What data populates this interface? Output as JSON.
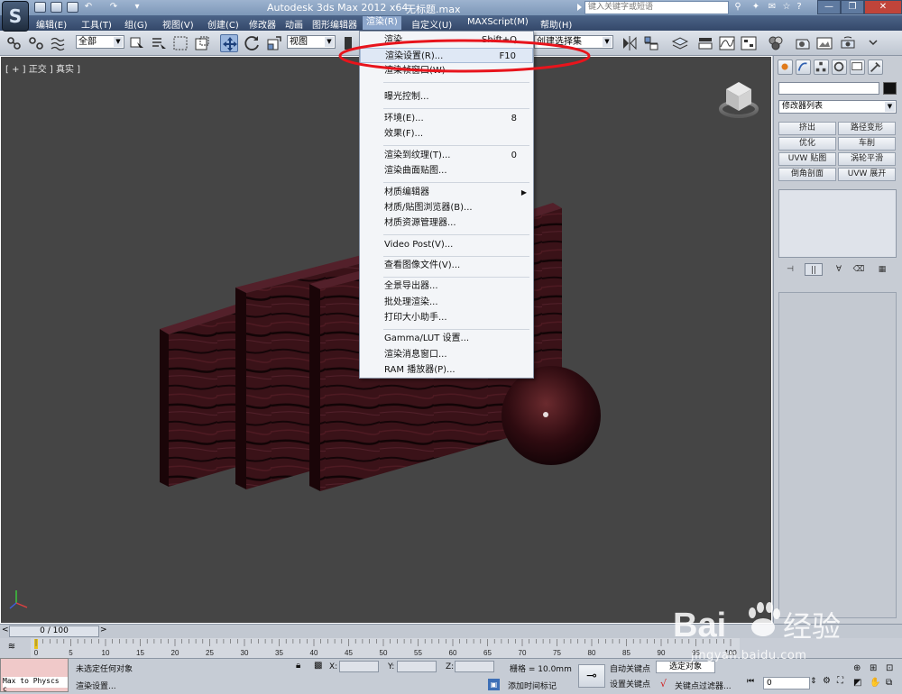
{
  "window": {
    "app_title": "Autodesk 3ds Max  2012 x64",
    "file_title": "无标题.max",
    "search_placeholder": "键入关键字或短语"
  },
  "menubar": {
    "items": [
      "编辑(E)",
      "工具(T)",
      "组(G)",
      "视图(V)",
      "创建(C)",
      "修改器",
      "动画",
      "图形编辑器",
      "渲染(R)",
      "自定义(U)",
      "MAXScript(M)",
      "帮助(H)"
    ],
    "active_item": "渲染(R)"
  },
  "toolbar": {
    "selection_filter": "全部",
    "reference_coord": "视图",
    "named_selection": "创建选择集"
  },
  "viewport": {
    "label": "[ + ] 正交 ] 真实 ]"
  },
  "render_menu": {
    "items": [
      {
        "label": "渲染",
        "shortcut": "Shift+Q"
      },
      {
        "label": "渲染设置(R)...",
        "shortcut": "F10",
        "highlighted": true
      },
      {
        "label": "渲染帧窗口(W)",
        "shortcut": ""
      },
      {
        "label": "曝光控制...",
        "shortcut": ""
      },
      {
        "label": "环境(E)...",
        "shortcut": "8"
      },
      {
        "label": "效果(F)...",
        "shortcut": ""
      },
      {
        "label": "渲染到纹理(T)...",
        "shortcut": "0"
      },
      {
        "label": "渲染曲面贴图...",
        "shortcut": ""
      },
      {
        "label": "材质编辑器",
        "shortcut": "",
        "submenu": true
      },
      {
        "label": "材质/贴图浏览器(B)...",
        "shortcut": ""
      },
      {
        "label": "材质资源管理器...",
        "shortcut": ""
      },
      {
        "label": "Video Post(V)...",
        "shortcut": ""
      },
      {
        "label": "查看图像文件(V)...",
        "shortcut": ""
      },
      {
        "label": "全景导出器...",
        "shortcut": ""
      },
      {
        "label": "批处理渲染...",
        "shortcut": ""
      },
      {
        "label": "打印大小助手...",
        "shortcut": ""
      },
      {
        "label": "Gamma/LUT 设置...",
        "shortcut": ""
      },
      {
        "label": "渲染消息窗口...",
        "shortcut": ""
      },
      {
        "label": "RAM 播放器(P)...",
        "shortcut": ""
      }
    ]
  },
  "command_panel": {
    "modifier_list": "修改器列表",
    "modifiers": [
      "挤出",
      "路径变形",
      "优化",
      "车削",
      "UVW 贴图",
      "涡轮平滑",
      "倒角剖面",
      "UVW 展开"
    ]
  },
  "timeline": {
    "slider": "0 / 100",
    "ticks": [
      "0",
      "5",
      "10",
      "15",
      "20",
      "25",
      "30",
      "35",
      "40",
      "45",
      "50",
      "55",
      "60",
      "65",
      "70",
      "75",
      "80",
      "85",
      "90",
      "95",
      "100"
    ]
  },
  "status": {
    "maxscript": "Max to Physcs c",
    "selection": "未选定任何对象",
    "prompt": "渲染设置...",
    "x_label": "X:",
    "y_label": "Y:",
    "z_label": "Z:",
    "grid": "栅格 = 10.0mm",
    "add_time_tag": "添加时间标记",
    "auto_key": "自动关键点",
    "set_key": "设置关键点",
    "selected_object": "选定对象",
    "key_filter": "关键点过滤器...",
    "frame": "0"
  },
  "watermark": {
    "brand": "Bai",
    "brand2": "经验",
    "url": "jingyan.baidu.com"
  }
}
